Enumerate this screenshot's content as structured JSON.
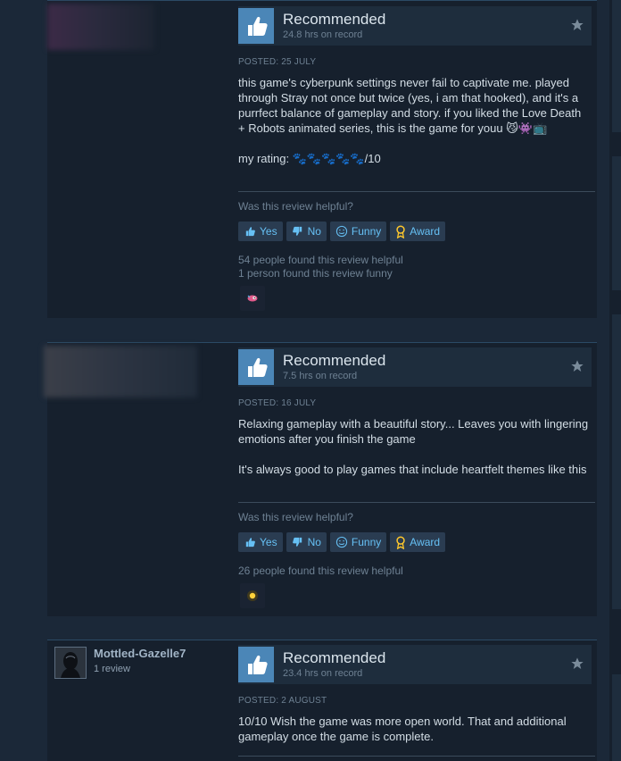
{
  "colors": {
    "accent": "#66c0f4",
    "thumb_bg": "#4b86b7",
    "panel": "#16202d",
    "page": "#1b2838"
  },
  "reviews": [
    {
      "recommendation": "Recommended",
      "hours": "24.8 hrs on record",
      "posted": "POSTED: 25 JULY",
      "body": "this game's cyberpunk settings never fail to captivate me. played through Stray not once but twice (yes, i am that hooked), and it's a purrfect balance of gameplay and story. if you liked the Love Death + Robots animated series, this is the game for youu 😼👾📺\n\nmy rating: 🐾🐾🐾🐾🐾/10",
      "helpful_question": "Was this review helpful?",
      "buttons": {
        "yes": "Yes",
        "no": "No",
        "funny": "Funny",
        "award": "Award"
      },
      "helpful_count": "54 people found this review helpful",
      "funny_count": "1 person found this review funny",
      "award_icon": "award-emoji-icon"
    },
    {
      "recommendation": "Recommended",
      "hours": "7.5 hrs on record",
      "posted": "POSTED: 16 JULY",
      "body": "Relaxing gameplay with a beautiful story... Leaves you with lingering emotions after you finish the game\n\nIt's always good to play games that include heartfelt themes like this",
      "helpful_question": "Was this review helpful?",
      "buttons": {
        "yes": "Yes",
        "no": "No",
        "funny": "Funny",
        "award": "Award"
      },
      "helpful_count": "26 people found this review helpful",
      "award_icon": "award-glow-icon"
    },
    {
      "author": {
        "name": "Mottled-Gazelle7",
        "review_count": "1 review"
      },
      "recommendation": "Recommended",
      "hours": "23.4 hrs on record",
      "posted": "POSTED: 2 AUGUST",
      "body": "10/10 Wish the game was more open world. That and additional gameplay once the game is complete."
    }
  ]
}
